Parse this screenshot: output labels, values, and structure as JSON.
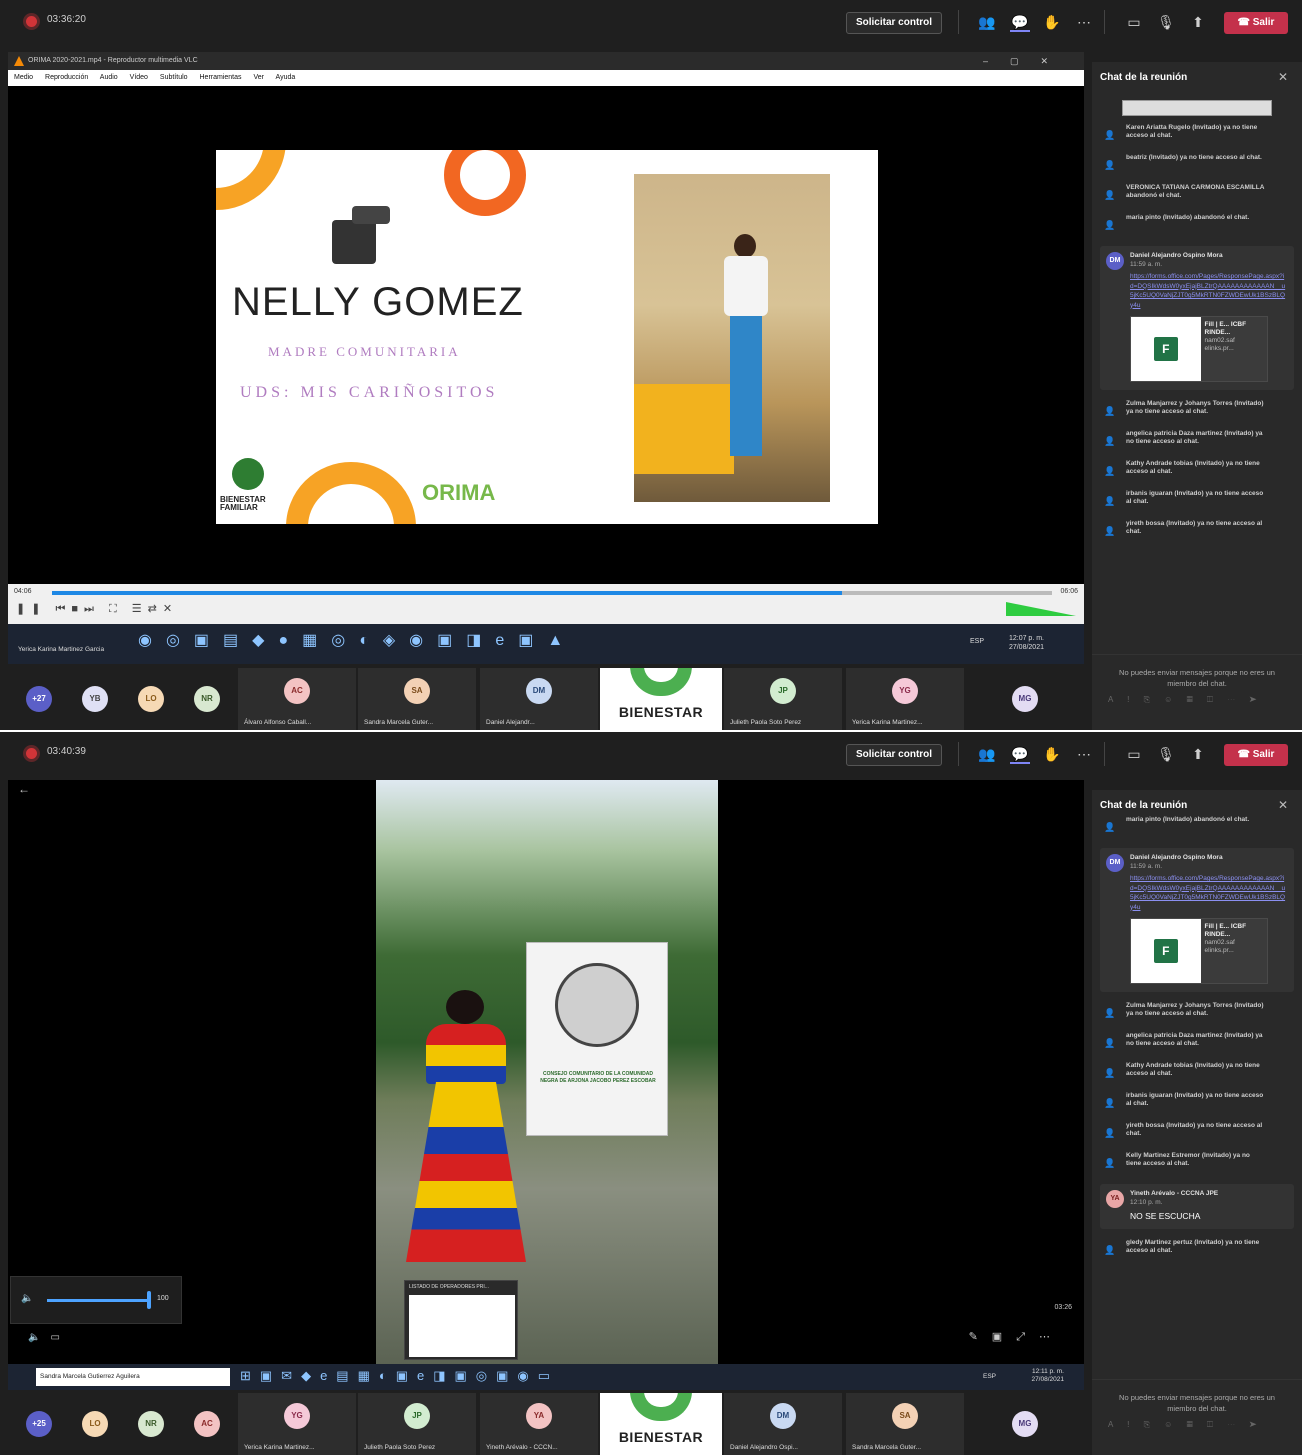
{
  "shot1": {
    "timer": "03:36:20",
    "control_button": "Solicitar control",
    "leave_button": "Salir",
    "chat_title": "Chat de la reunión",
    "vlc": {
      "title": "ORIMA 2020-2021.mp4 - Reproductor multimedia VLC",
      "menu": [
        "Medio",
        "Reproducción",
        "Audio",
        "Vídeo",
        "Subtítulo",
        "Herramientas",
        "Ver",
        "Ayuda"
      ],
      "time_elapsed": "04:06",
      "time_total": "06:06",
      "progress_fraction": 0.79,
      "volume": "100%"
    },
    "slide": {
      "name": "NELLY GOMEZ",
      "role": "MADRE COMUNITARIA",
      "uds": "UDS: MIS CARIÑOSITOS",
      "logo_text": "BIENESTAR FAMILIAR",
      "brand": "ORIMA"
    },
    "taskbar": {
      "user": "Yerica Karina Martinez Garcia",
      "lang": "ESP",
      "time": "12:07 p. m.",
      "date": "27/08/2021"
    },
    "chat": {
      "system_top": [
        "Karen Ariatta Rugelo (Invitado) ya no tiene acceso al chat.",
        "beatriz (Invitado) ya no tiene acceso al chat.",
        "VERONICA TATIANA CARMONA ESCAMILLA abandonó el chat.",
        "maria pinto (Invitado) abandonó el chat."
      ],
      "message": {
        "initials": "DM",
        "author": "Daniel Alejandro Ospino Mora",
        "time": "11:59 a. m.",
        "link": "https://forms.office.com/Pages/ResponsePage.aspx?id=DQSIkWdsW0yxEjajBLZtrQAAAAAAAAAAAAN__u5jKc5UQ0VaNjZJT0g5MkRTN0FZWDEwUk1BSzBLQy4u",
        "file_name": "Fill | E... ICBF RINDE...",
        "file_meta": "nam02.saf elinks.pr..."
      },
      "system_bottom": [
        "Zulma Manjarrez y Johanys Torres (Invitado) ya no tiene acceso al chat.",
        "angelica patricia Daza martinez (Invitado) ya no tiene acceso al chat.",
        "Kathy Andrade tobias (Invitado) ya no tiene acceso al chat.",
        "irbanis iguaran (Invitado) ya no tiene acceso al chat.",
        "yireth bossa (Invitado) ya no tiene acceso al chat."
      ],
      "footer": "No puedes enviar mensajes porque no eres un miembro del chat."
    },
    "participants": {
      "more": "+27",
      "circles": [
        "YB",
        "LO",
        "NR"
      ],
      "tiles": [
        {
          "initials": "AC",
          "name": "Álvaro Alfonso Caball..."
        },
        {
          "initials": "SA",
          "name": "Sandra Marcela Guter..."
        },
        {
          "initials": "DM",
          "name": "Daniel Alejandr..."
        }
      ],
      "bienestar": "BIENESTAR",
      "tiles_after": [
        {
          "initials": "JP",
          "name": "Julieth Paola Soto Perez"
        },
        {
          "initials": "YG",
          "name": "Yerica Karina Martinez..."
        }
      ],
      "last": "MG"
    }
  },
  "shot2": {
    "timer": "03:40:39",
    "control_button": "Solicitar control",
    "leave_button": "Salir",
    "chat_title": "Chat de la reunión",
    "video": {
      "banner_text": "CONSEJO COMUNITARIO DE LA COMUNIDAD NEGRA DE ARJONA JACOBO PEREZ ESCOBAR",
      "volume": "100",
      "time": "03:26",
      "thumb_title": "LISTADO DE OPERADORES PRI..."
    },
    "taskbar": {
      "search": "Sandra Marcela Gutierrez Aguilera",
      "lang": "ESP",
      "time": "12:11 p. m.",
      "date": "27/08/2021"
    },
    "chat": {
      "system_top": [
        "maria pinto (Invitado) abandonó el chat."
      ],
      "message": {
        "initials": "DM",
        "author": "Daniel Alejandro Ospino Mora",
        "time": "11:59 a. m.",
        "link": "https://forms.office.com/Pages/ResponsePage.aspx?id=DQSIkWdsW0yxEjajBLZtrQAAAAAAAAAAAAN__u5jKc5UQ0VaNjZJT0g5MkRTN0FZWDEwUk1BSzBLQy4u",
        "file_name": "Fill | E... ICBF RINDE...",
        "file_meta": "nam02.saf elinks.pr..."
      },
      "system_mid": [
        "Zulma Manjarrez y Johanys Torres (Invitado) ya no tiene acceso al chat.",
        "angelica patricia Daza martinez (Invitado) ya no tiene acceso al chat.",
        "Kathy Andrade tobias (Invitado) ya no tiene acceso al chat.",
        "irbanis iguaran (Invitado) ya no tiene acceso al chat.",
        "yireth bossa (Invitado) ya no tiene acceso al chat.",
        "Kelly Martinez Estremor (Invitado) ya no tiene acceso al chat."
      ],
      "message2": {
        "initials": "YA",
        "author": "Yineth Arévalo - CCCNA JPE",
        "time": "12:10 p. m.",
        "body": "NO SE ESCUCHA"
      },
      "system_last": "gledy Martinez pertuz (Invitado) ya no tiene acceso al chat.",
      "footer": "No puedes enviar mensajes porque no eres un miembro del chat."
    },
    "participants": {
      "more": "+25",
      "circles": [
        "LO",
        "NR",
        "AC"
      ],
      "tiles": [
        {
          "initials": "YG",
          "name": "Yerica Karina Martinez..."
        },
        {
          "initials": "JP",
          "name": "Julieth Paola Soto Perez"
        },
        {
          "initials": "YA",
          "name": "Yineth Arévalo - CCCN..."
        }
      ],
      "bienestar": "BIENESTAR",
      "tiles_after": [
        {
          "initials": "DM",
          "name": "Daniel Alejandro Ospi..."
        },
        {
          "initials": "SA",
          "name": "Sandra Marcela Guter..."
        }
      ],
      "last": "MG"
    }
  },
  "colors": {
    "leave_red": "#c4314b",
    "teams_purple": "#5b5fc7",
    "vlc_orange": "#f58a07"
  }
}
